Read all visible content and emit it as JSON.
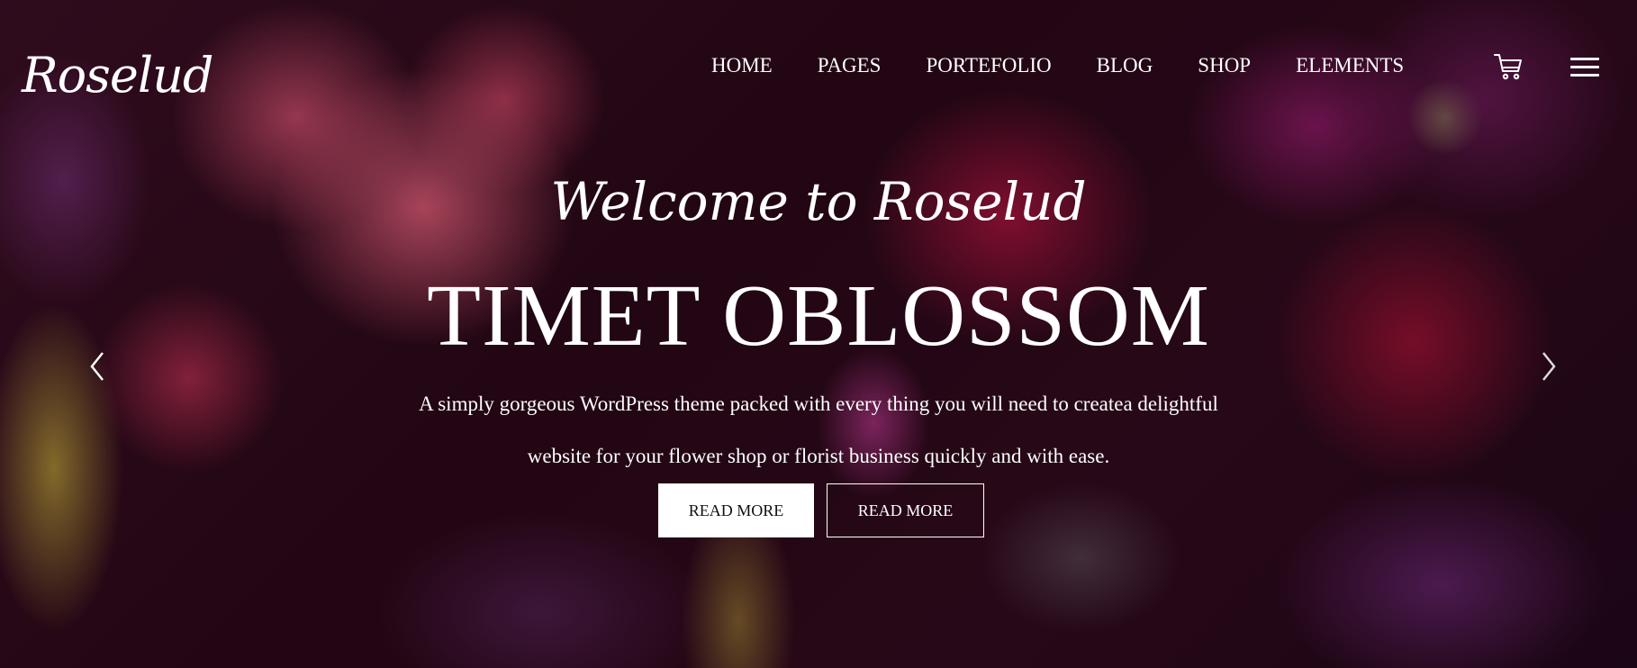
{
  "brand": {
    "logo": "Roselud"
  },
  "nav": {
    "items": [
      "HOME",
      "PAGES",
      "PORTEFOLIO",
      "BLOG",
      "SHOP",
      "ELEMENTS"
    ],
    "cart_icon": "cart-icon",
    "menu_icon": "hamburger-menu-icon"
  },
  "hero": {
    "welcome": "Welcome to Roselud",
    "title": "TIMET OBLOSSOM",
    "description_line1": "A simply gorgeous WordPress theme packed with every thing you will need to createa delightful",
    "description_line2": "website for your flower shop or florist business quickly and with ease.",
    "button_primary": "READ MORE",
    "button_secondary": "READ MORE",
    "prev_icon": "chevron-left-icon",
    "next_icon": "chevron-right-icon"
  },
  "colors": {
    "text": "#ffffff",
    "button_text_dark": "#111111"
  }
}
